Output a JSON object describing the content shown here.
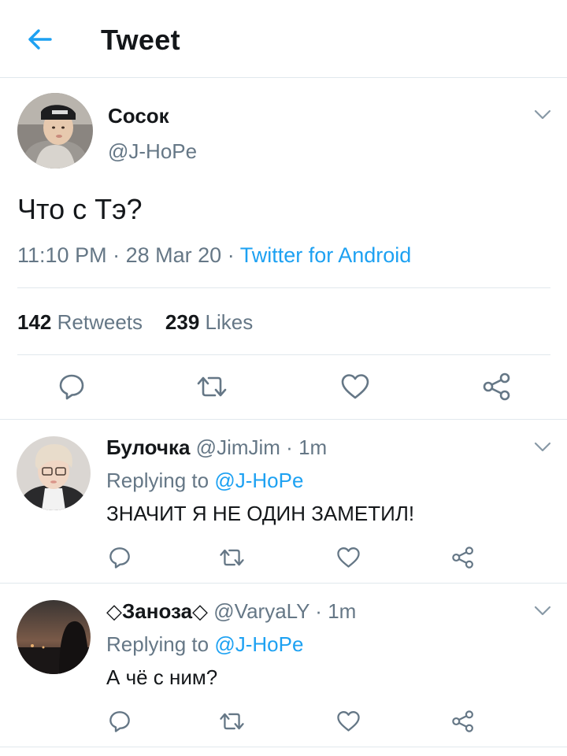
{
  "header": {
    "title": "Tweet",
    "back_icon": "arrow-left-icon"
  },
  "colors": {
    "accent": "#1da1f2",
    "text": "#14171a",
    "secondary": "#657786",
    "border": "#e1e8ed"
  },
  "main_tweet": {
    "name": "Сосок",
    "handle": "@J-HoPe",
    "text": "Что с Тэ?",
    "time": "11:10 PM",
    "date": "28 Mar 20",
    "source": "Twitter for Android",
    "retweets_count": "142",
    "retweets_label": "Retweets",
    "likes_count": "239",
    "likes_label": "Likes"
  },
  "replies": [
    {
      "name": "Булочка",
      "handle": "@JimJim",
      "time": "1m",
      "replying_prefix": "Replying to",
      "replying_to": "@J-HoPe",
      "text": "ЗНАЧИТ Я НЕ ОДИН ЗАМЕТИЛ!"
    },
    {
      "name": "◇Заноза◇",
      "handle": "@VaryaLY",
      "time": "1m",
      "replying_prefix": "Replying to",
      "replying_to": "@J-HoPe",
      "text": "А чё с ним?"
    }
  ],
  "separator": "·"
}
